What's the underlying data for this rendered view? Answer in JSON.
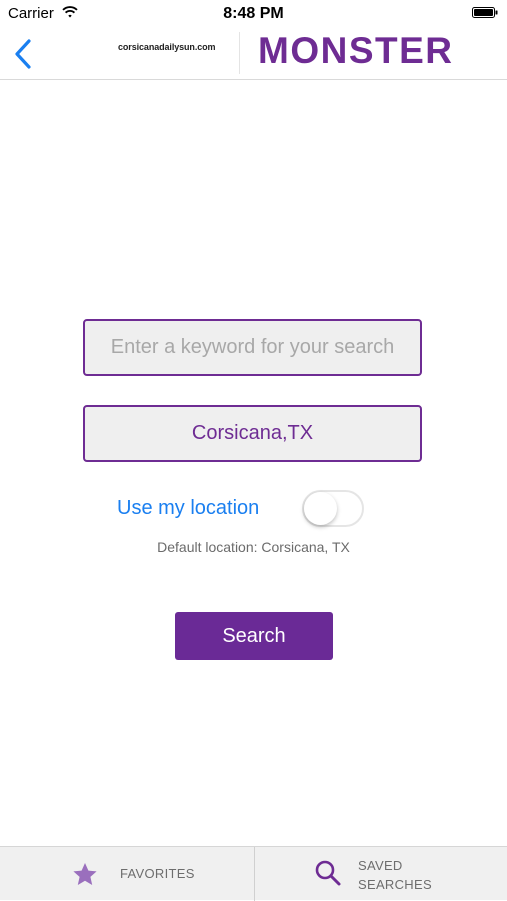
{
  "status_bar": {
    "carrier": "Carrier",
    "time": "8:48 PM"
  },
  "nav": {
    "back_icon": "chevron-left-icon",
    "partner_logo": "corsicanadailysun.com",
    "brand_logo": "MONSTER"
  },
  "search_form": {
    "keyword": {
      "value": "",
      "placeholder": "Enter a keyword for your search"
    },
    "location": {
      "value": "Corsicana,TX"
    },
    "use_location_label": "Use my location",
    "use_location_enabled": false,
    "default_location": "Default location: Corsicana, TX",
    "search_button": "Search"
  },
  "tab_bar": {
    "favorites": {
      "label": "FAVORITES",
      "icon": "star-icon"
    },
    "saved_searches": {
      "label": "SAVED SEARCHES",
      "icon": "search-icon"
    }
  },
  "colors": {
    "brand_purple": "#6e2c93",
    "link_blue": "#1a7ff0",
    "button_purple": "#6a2a96"
  }
}
